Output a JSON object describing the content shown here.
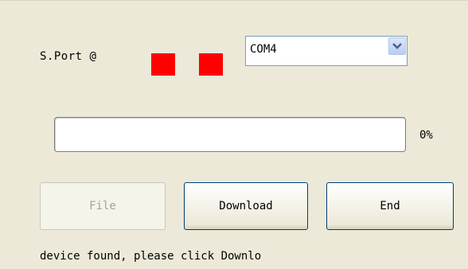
{
  "port": {
    "label": "S.Port @",
    "indicator_color": "#ff0000",
    "selected_port": "COM4"
  },
  "progress": {
    "value_percent": 0,
    "label": "0%"
  },
  "buttons": {
    "file_label": "File",
    "download_label": "Download",
    "end_label": "End"
  },
  "status": {
    "message": "device found, please click Downlo"
  },
  "icons": {
    "dropdown": "chevron-down-icon"
  }
}
